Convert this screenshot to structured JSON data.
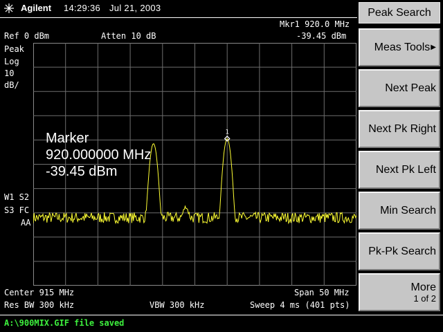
{
  "header": {
    "brand": "Agilent",
    "time": "14:29:36",
    "date": "Jul 21, 2003"
  },
  "display": {
    "ref_level": "Ref 0 dBm",
    "attenuation": "Atten 10 dB",
    "marker_freq": "Mkr1  920.0 MHz",
    "marker_ampl": "-39.45 dBm",
    "detector": "Peak",
    "scale_type": "Log",
    "scale_value": "10",
    "scale_units": "dB/",
    "trace_flags_line1": "W1  S2",
    "trace_flags_line2": "S3  FC",
    "trace_flags_line3": "AA",
    "center": "Center 915 MHz",
    "span": "Span 50 MHz",
    "res_bw": "Res BW 300 kHz",
    "vbw": "VBW 300 kHz",
    "sweep": "Sweep 4 ms (401 pts)",
    "marker_number": "1"
  },
  "marker_readout": {
    "label": "Marker",
    "frequency": "920.000000 MHz",
    "amplitude": "-39.45 dBm"
  },
  "softkeys": {
    "title": "Peak Search",
    "items": [
      {
        "label": "Meas Tools",
        "has_submenu": true
      },
      {
        "label": "Next Peak"
      },
      {
        "label": "Next Pk Right"
      },
      {
        "label": "Next Pk Left"
      },
      {
        "label": "Min Search"
      },
      {
        "label": "Pk-Pk Search"
      }
    ],
    "more_label": "More",
    "more_page": "1 of 2"
  },
  "status": {
    "message": "A:\\900MIX.GIF file saved"
  },
  "colors": {
    "trace": "#ffff33",
    "status_text": "#3df03d",
    "softkey_bg": "#c6c6c6",
    "grid": "#6e6e6e"
  },
  "chart_data": {
    "type": "line",
    "x_range_mhz": [
      890,
      940
    ],
    "y_range_dbm": [
      -100,
      0
    ],
    "noise_floor_dbm": -72,
    "peaks": [
      {
        "freq_mhz": 908.6,
        "ampl_dbm": -41.5
      },
      {
        "freq_mhz": 913.6,
        "ampl_dbm": -69.5
      },
      {
        "freq_mhz": 920.0,
        "ampl_dbm": -39.45
      }
    ],
    "marker": {
      "freq_mhz": 920.0,
      "ampl_dbm": -39.45
    }
  }
}
